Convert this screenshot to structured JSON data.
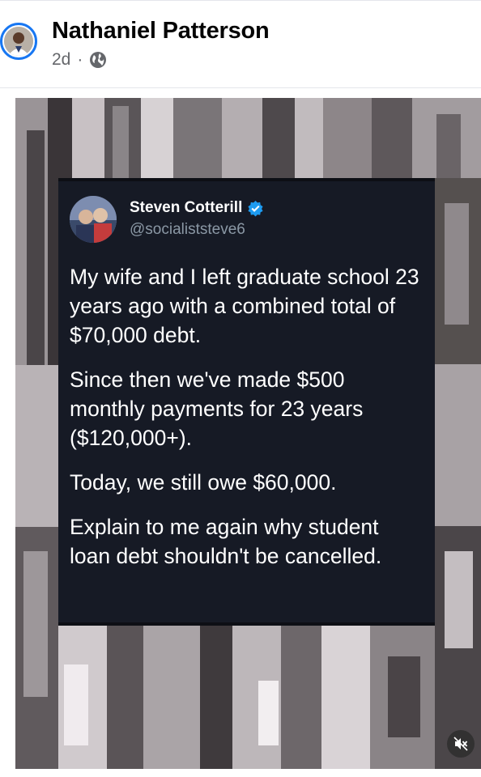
{
  "post": {
    "author": "Nathaniel Patterson",
    "timestamp": "2d",
    "separator": "·",
    "audience_icon": "globe-icon"
  },
  "tweet": {
    "name": "Steven Cotterill",
    "handle": "@socialiststeve6",
    "verified_icon": "verified-badge-icon",
    "paragraphs": [
      "My wife and I left graduate school 23 years ago with a combined total of $70,000 debt.",
      "Since then we've made $500 monthly payments for 23 years ($120,000+).",
      "Today, we still owe $60,000.",
      "Explain to me again why student loan debt shouldn't be cancelled."
    ]
  },
  "video": {
    "mute_icon": "muted-speaker-icon"
  },
  "colors": {
    "accent": "#1877f2",
    "tweet_bg": "#161a25",
    "handle": "#8b98a5"
  }
}
